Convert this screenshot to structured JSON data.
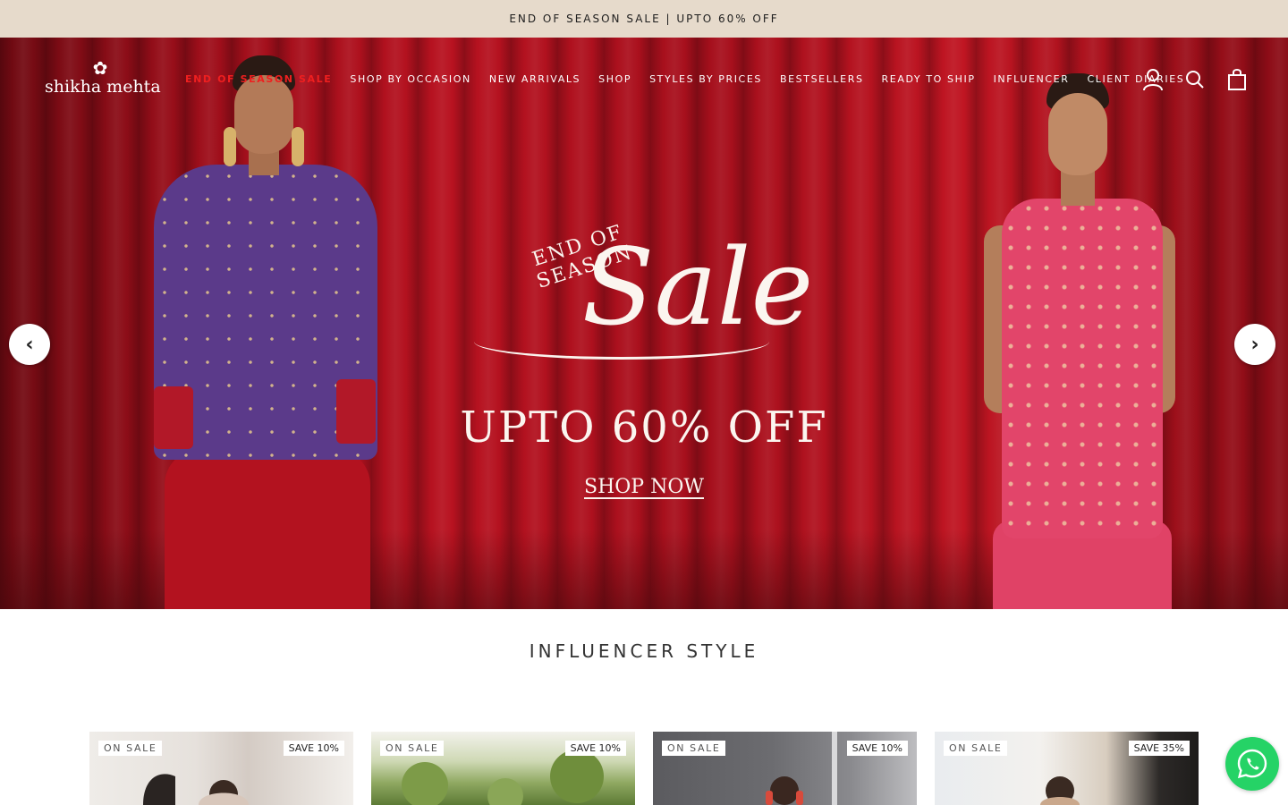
{
  "announcement": {
    "text": "END OF SEASON SALE | UPTO 60% OFF"
  },
  "logo": {
    "text": "shikha mehta"
  },
  "nav": {
    "items": [
      "END OF SEASON SALE",
      "SHOP BY OCCASION",
      "NEW ARRIVALS",
      "SHOP",
      "STYLES BY PRICES",
      "BESTSELLERS",
      "READY TO SHIP",
      "INFLUENCER",
      "CLIENT DIARIES"
    ],
    "active_color": "#ef1f1f"
  },
  "header_icons": [
    "account-icon",
    "search-icon",
    "cart-bag-icon"
  ],
  "hero": {
    "eyebrow": "END OF SEASON",
    "headline": "Sale",
    "offer": "UPTO 60% OFF",
    "cta": "SHOP NOW",
    "background_color": "#b81220"
  },
  "section": {
    "title": "INFLUENCER STYLE"
  },
  "products": [
    {
      "sale_badge": "ON SALE",
      "save_badge": "SAVE 10%"
    },
    {
      "sale_badge": "ON SALE",
      "save_badge": "SAVE 10%"
    },
    {
      "sale_badge": "ON SALE",
      "save_badge": "SAVE 10%"
    },
    {
      "sale_badge": "ON SALE",
      "save_badge": "SAVE 35%"
    }
  ],
  "colors": {
    "announcement_bg": "#e6dacb",
    "whatsapp": "#25d366"
  }
}
